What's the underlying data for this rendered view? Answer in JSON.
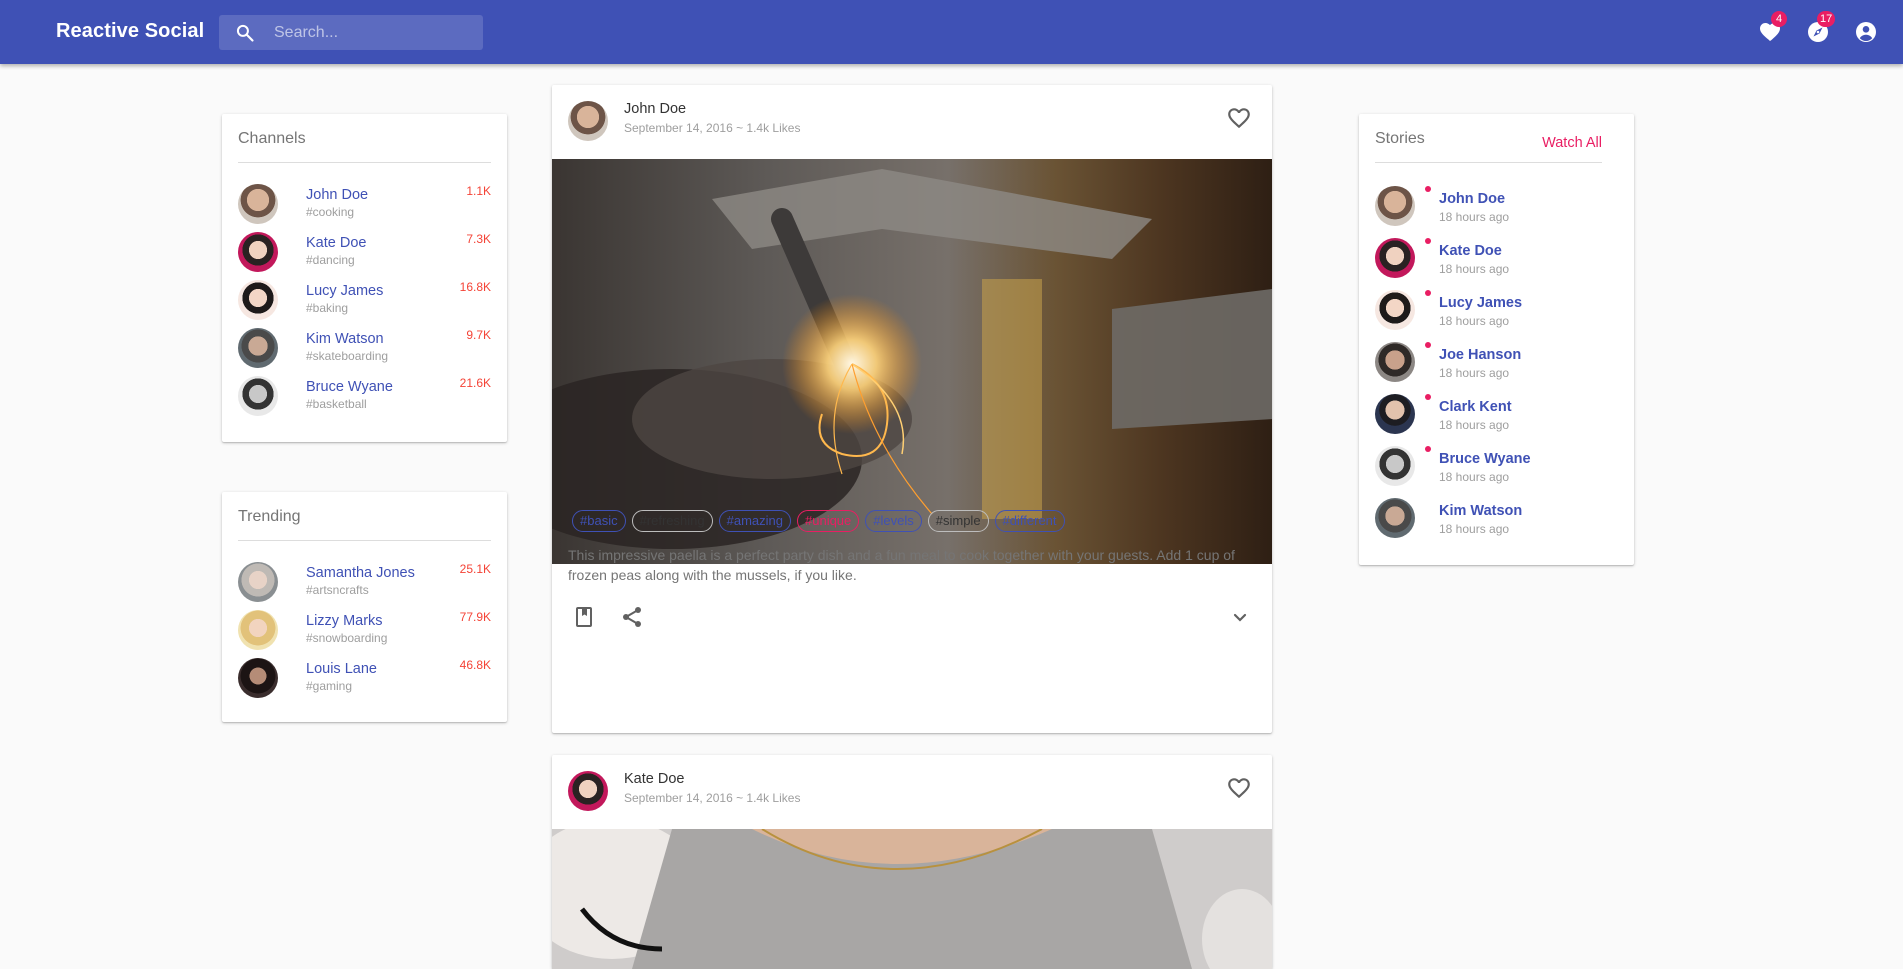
{
  "app": {
    "brand": "Reactive Social",
    "search_placeholder": "Search...",
    "favorites_badge": "4",
    "explore_badge": "17",
    "colors": {
      "primary": "#3f51b5",
      "accent": "#e91e63",
      "count": "#f44336"
    },
    "icons": [
      "search-icon",
      "heart-icon",
      "compass-icon",
      "account-circle-icon"
    ]
  },
  "channels": {
    "title": "Channels",
    "items": [
      {
        "name": "John Doe",
        "tag": "#cooking",
        "count": "1.1K"
      },
      {
        "name": "Kate Doe",
        "tag": "#dancing",
        "count": "7.3K"
      },
      {
        "name": "Lucy James",
        "tag": "#baking",
        "count": "16.8K"
      },
      {
        "name": "Kim Watson",
        "tag": "#skateboarding",
        "count": "9.7K"
      },
      {
        "name": "Bruce Wyane",
        "tag": "#basketball",
        "count": "21.6K"
      }
    ]
  },
  "trending": {
    "title": "Trending",
    "items": [
      {
        "name": "Samantha Jones",
        "tag": "#artsncrafts",
        "count": "25.1K"
      },
      {
        "name": "Lizzy Marks",
        "tag": "#snowboarding",
        "count": "77.9K"
      },
      {
        "name": "Louis Lane",
        "tag": "#gaming",
        "count": "46.8K"
      }
    ]
  },
  "stories": {
    "title": "Stories",
    "watch_all": "Watch All",
    "items": [
      {
        "name": "John Doe",
        "time": "18 hours ago"
      },
      {
        "name": "Kate Doe",
        "time": "18 hours ago"
      },
      {
        "name": "Lucy James",
        "time": "18 hours ago"
      },
      {
        "name": "Joe Hanson",
        "time": "18 hours ago"
      },
      {
        "name": "Clark Kent",
        "time": "18 hours ago"
      },
      {
        "name": "Bruce Wyane",
        "time": "18 hours ago"
      },
      {
        "name": "Kim Watson",
        "time": "18 hours ago"
      }
    ]
  },
  "posts": [
    {
      "author": "John Doe",
      "meta": "September 14, 2016 ~ 1.4k Likes",
      "tags": [
        "#basic",
        "#refreshing",
        "#amazing",
        "#unique",
        "#levels",
        "#simple",
        "#different"
      ],
      "text": "This impressive paella is a perfect party dish and a fun meal to cook together with your guests. Add 1 cup of frozen peas along with the mussels, if you like."
    },
    {
      "author": "Kate Doe",
      "meta": "September 14, 2016 ~ 1.4k Likes"
    }
  ]
}
